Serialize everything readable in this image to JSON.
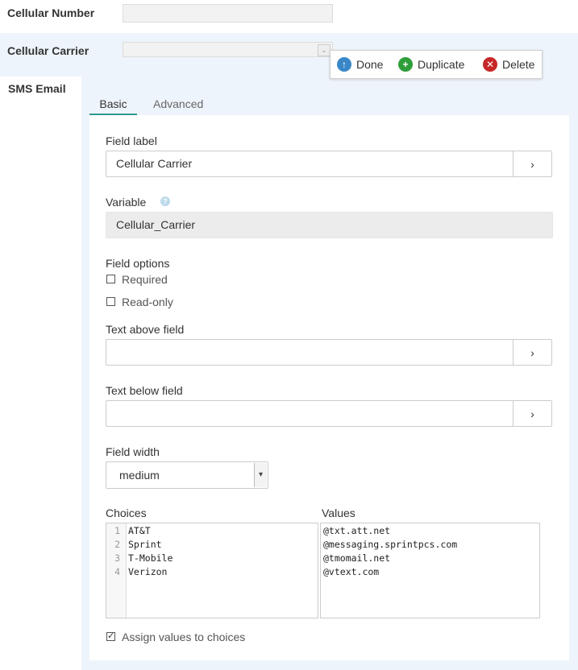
{
  "form": {
    "cellular_number_label": "Cellular Number",
    "cellular_carrier_label": "Cellular Carrier",
    "sms_email_label": "SMS Email"
  },
  "toolbar": {
    "done_label": "Done",
    "duplicate_label": "Duplicate",
    "delete_label": "Delete"
  },
  "tabs": {
    "basic": "Basic",
    "advanced": "Advanced"
  },
  "editor": {
    "field_label_heading": "Field label",
    "field_label_value": "Cellular Carrier",
    "variable_heading": "Variable",
    "variable_value": "Cellular_Carrier",
    "field_options_heading": "Field options",
    "required_label": "Required",
    "readonly_label": "Read-only",
    "text_above_heading": "Text above field",
    "text_above_value": "",
    "text_below_heading": "Text below field",
    "text_below_value": "",
    "field_width_heading": "Field width",
    "field_width_value": "medium",
    "choices_heading": "Choices",
    "values_heading": "Values",
    "choices": [
      "AT&T",
      "Sprint",
      "T-Mobile",
      "Verizon"
    ],
    "line_numbers": [
      "1",
      "2",
      "3",
      "4"
    ],
    "values": [
      "@txt.att.net",
      "@messaging.sprintpcs.com",
      "@tmomail.net",
      "@vtext.com"
    ],
    "assign_values_label": "Assign values to choices",
    "assign_values_checked": true,
    "required_checked": false,
    "readonly_checked": false
  },
  "icons": {
    "arrow_glyph": "›",
    "check_glyph": "✓"
  },
  "colors": {
    "done": "#3a87c8",
    "duplicate": "#2f9e3a",
    "delete": "#c62828",
    "tab_accent": "#2a9a8e",
    "panel_bg": "#eef4fb"
  }
}
